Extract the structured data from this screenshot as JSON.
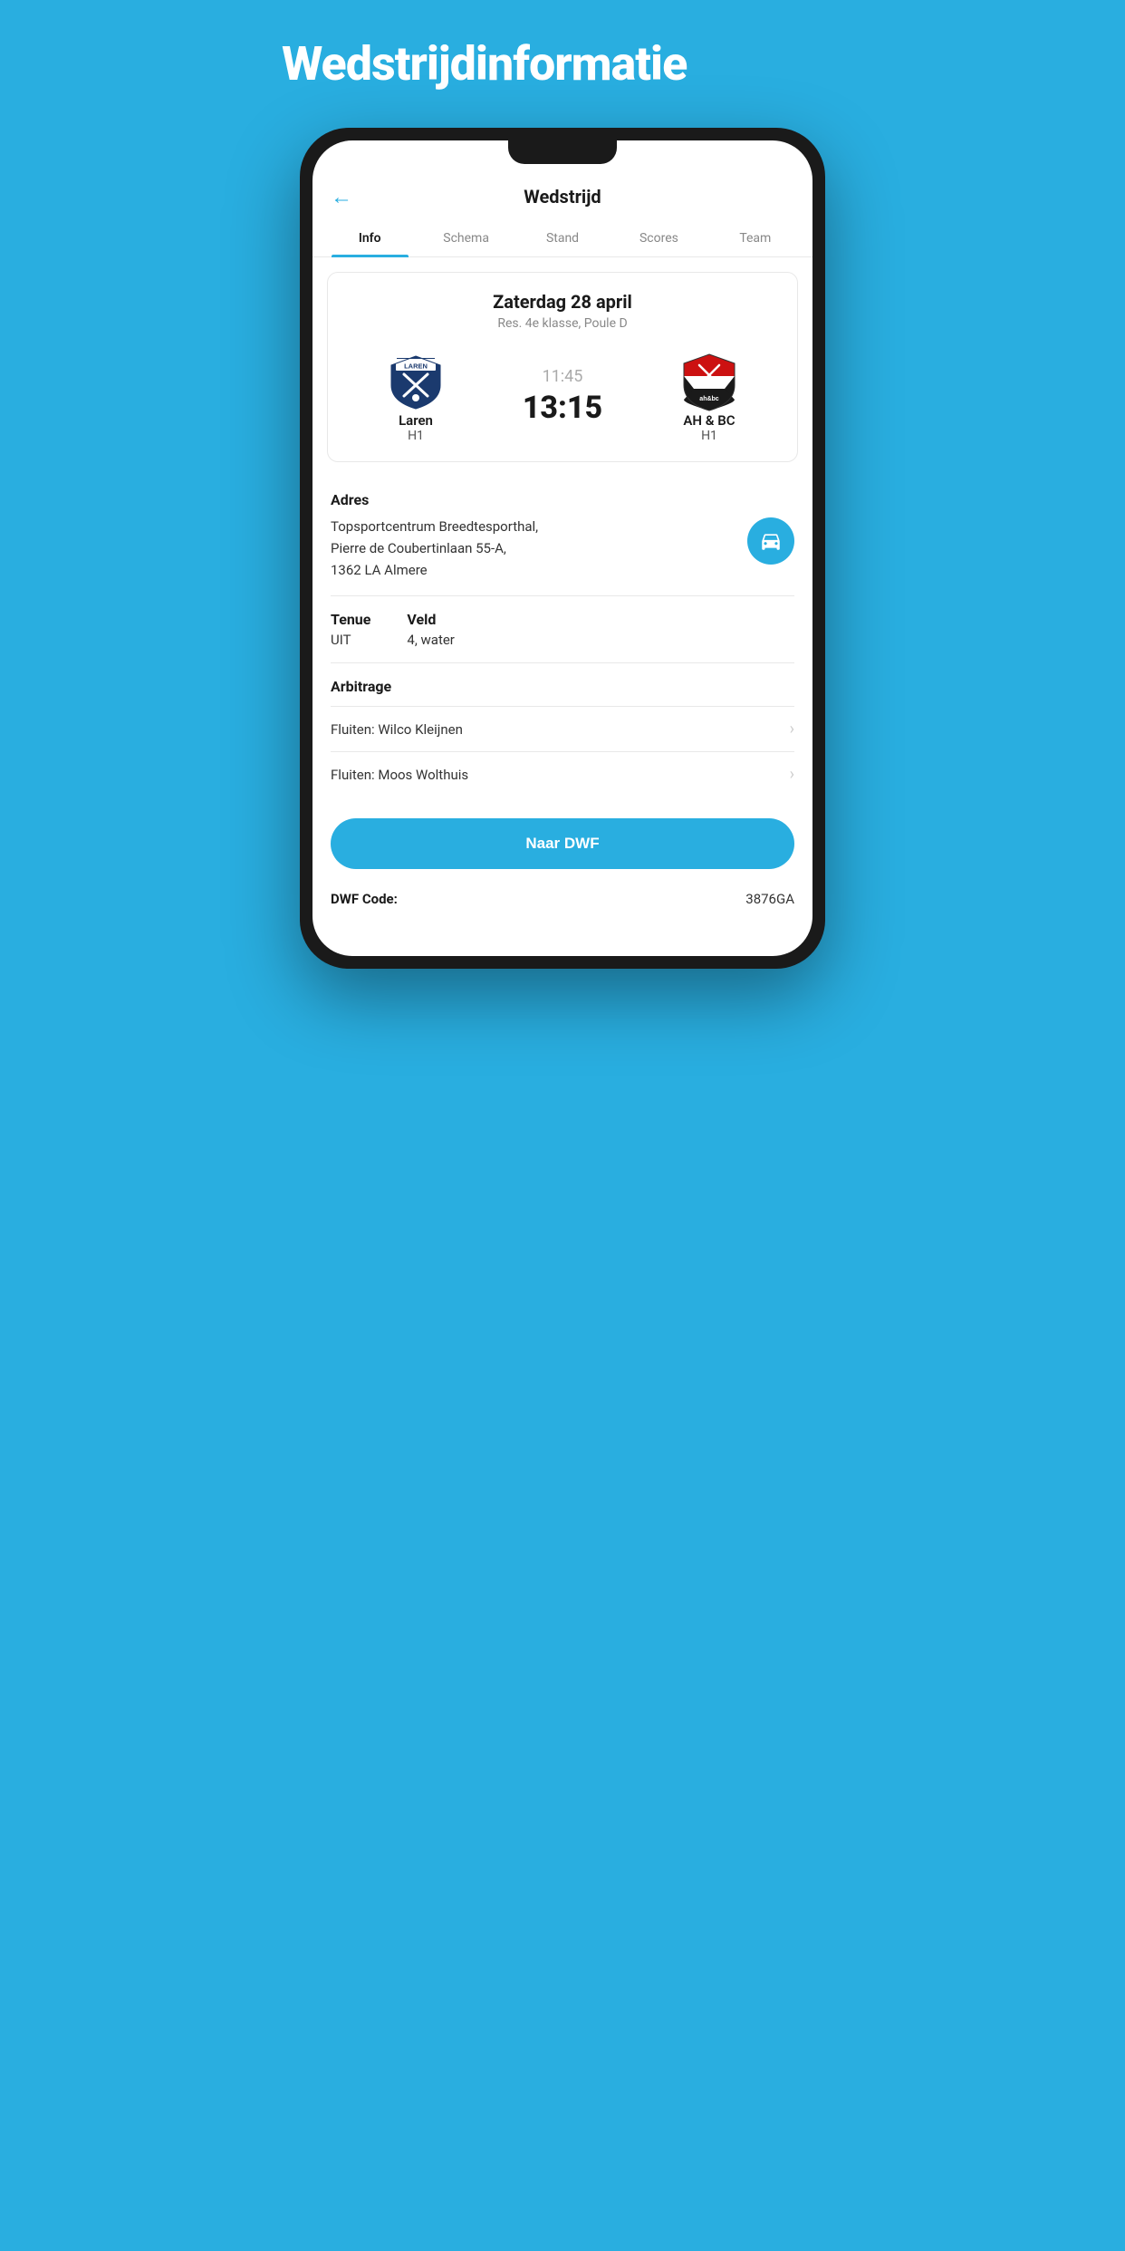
{
  "page": {
    "bg_title": "Wedstrijdinformatie",
    "app_title": "Wedstrijd",
    "back_label": "←"
  },
  "tabs": [
    {
      "id": "info",
      "label": "Info",
      "active": true
    },
    {
      "id": "schema",
      "label": "Schema",
      "active": false
    },
    {
      "id": "stand",
      "label": "Stand",
      "active": false
    },
    {
      "id": "scores",
      "label": "Scores",
      "active": false
    },
    {
      "id": "team",
      "label": "Team",
      "active": false
    }
  ],
  "match": {
    "date": "Zaterdag 28 april",
    "league": "Res. 4e klasse, Poule D",
    "home_team": "Laren",
    "home_sub": "H1",
    "away_team": "AH & BC",
    "away_sub": "H1",
    "time": "11:45",
    "score": "13:15"
  },
  "info": {
    "address_label": "Adres",
    "address": "Topsportcentrum Breedtesporthal,\nPierre de Coubertinlaan 55-A,\n1362 LA Almere",
    "tenue_label": "Tenue",
    "tenue_value": "UIT",
    "veld_label": "Veld",
    "veld_value": "4, water",
    "arbitrage_label": "Arbitrage",
    "referees": [
      {
        "label": "Fluiten: Wilco Kleijnen"
      },
      {
        "label": "Fluiten: Moos Wolthuis"
      }
    ],
    "dwf_button": "Naar DWF",
    "dwf_code_label": "DWF Code:",
    "dwf_code_value": "3876GA"
  },
  "colors": {
    "accent": "#29aee0",
    "text_dark": "#1a1a1a",
    "text_muted": "#888888"
  }
}
